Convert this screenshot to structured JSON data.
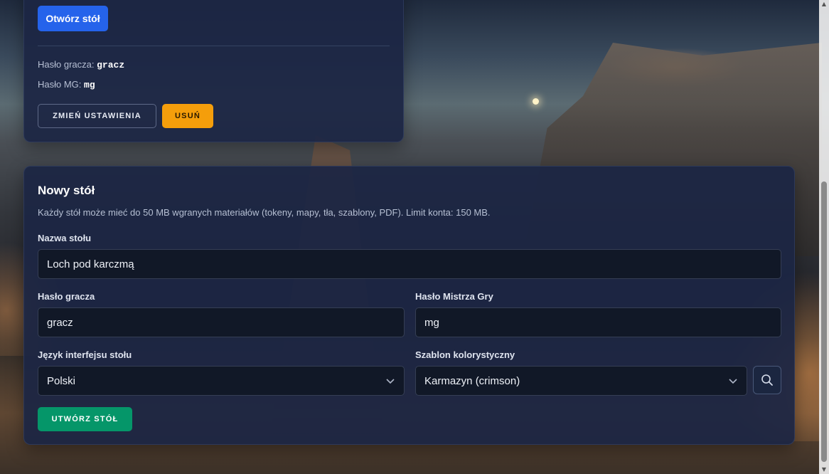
{
  "existing_table": {
    "open_button": "Otwórz stół",
    "player_password_label": "Hasło gracza:",
    "player_password_value": "gracz",
    "gm_password_label": "Hasło MG:",
    "gm_password_value": "mg",
    "settings_button": "ZMIEŃ USTAWIENIA",
    "delete_button": "USUŃ"
  },
  "new_table": {
    "title": "Nowy stół",
    "description": "Każdy stół może mieć do 50 MB wgranych materiałów (tokeny, mapy, tła, szablony, PDF). Limit konta: 150 MB.",
    "name_label": "Nazwa stołu",
    "name_value": "Loch pod karczmą",
    "player_password_label": "Hasło gracza",
    "player_password_value": "gracz",
    "gm_password_label": "Hasło Mistrza Gry",
    "gm_password_value": "mg",
    "language_label": "Język interfejsu stołu",
    "language_value": "Polski",
    "theme_label": "Szablon kolorystyczny",
    "theme_value": "Karmazyn (crimson)",
    "create_button": "UTWÓRZ STÓŁ"
  },
  "colors": {
    "primary": "#2563eb",
    "warning": "#f59e0b",
    "success": "#059669",
    "card": "#1c2644"
  },
  "icons": {
    "search": "search-icon",
    "chevron": "chevron-down-icon"
  }
}
